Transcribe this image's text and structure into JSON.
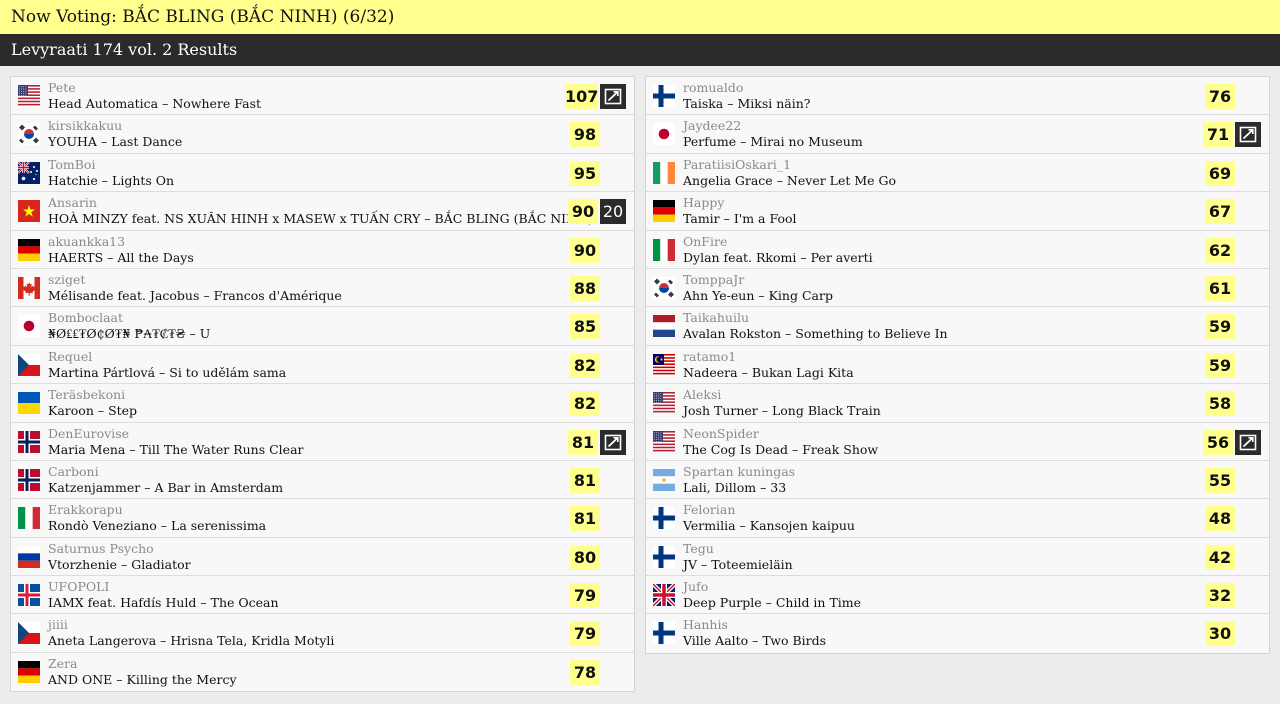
{
  "top_bar": {
    "text": "Now Voting: BẮC BLING (BẮC NINH) (6/32)"
  },
  "sub_bar": {
    "text": "Levyraati 174 vol. 2 Results"
  },
  "left": [
    {
      "flag": "us",
      "user": "Pete",
      "artist": "Head Automatica",
      "title": "Nowhere Fast",
      "score": "107",
      "badge": "check"
    },
    {
      "flag": "kr",
      "user": "kirsikkakuu",
      "artist": "YOUHA",
      "title": "Last Dance",
      "score": "98"
    },
    {
      "flag": "au",
      "user": "TomBoi",
      "artist": "Hatchie",
      "title": "Lights On",
      "score": "95"
    },
    {
      "flag": "vn",
      "user": "Ansarin",
      "artist": "HOÀ MINZY feat. NS XUÂN HINH x MASEW x TUẤN CRY",
      "title": "BẮC BLING (BẮC NINH)",
      "score": "90",
      "badge": "20"
    },
    {
      "flag": "de",
      "user": "akuankka13",
      "artist": "HAERTS",
      "title": "All the Days",
      "score": "90"
    },
    {
      "flag": "ca",
      "user": "sziget",
      "artist": "Mélisande feat. Jacobus",
      "title": "Francos d'Amérique",
      "score": "88"
    },
    {
      "flag": "jp",
      "user": "Bomboclaat",
      "artist": "₦Ø₤₤₮Ø₵Ø₮₦ ₱₳₮₡₮₴",
      "title": "U",
      "score": "85"
    },
    {
      "flag": "cz",
      "user": "Requel",
      "artist": "Martina Pártlová",
      "title": "Si to udělám sama",
      "score": "82"
    },
    {
      "flag": "ua",
      "user": "Teräsbekoni",
      "artist": "Karoon",
      "title": "Step",
      "score": "82"
    },
    {
      "flag": "no",
      "user": "DenEurovise",
      "artist": "Maria Mena",
      "title": "Till The Water Runs Clear",
      "score": "81",
      "badge": "check"
    },
    {
      "flag": "no",
      "user": "Carboni",
      "artist": "Katzenjammer",
      "title": "A Bar in Amsterdam",
      "score": "81"
    },
    {
      "flag": "it",
      "user": "Erakkorapu",
      "artist": "Rondò Veneziano",
      "title": "La serenissima",
      "score": "81"
    },
    {
      "flag": "ru",
      "user": "Saturnus Psycho",
      "artist": "Vtorzhenie",
      "title": "Gladiator",
      "score": "80"
    },
    {
      "flag": "is",
      "user": "UFOPOLI",
      "artist": "IAMX feat. Hafdís Huld",
      "title": "The Ocean",
      "score": "79"
    },
    {
      "flag": "cz",
      "user": "jiiii",
      "artist": "Aneta Langerova",
      "title": "Hrisna Tela, Kridla Motyli",
      "score": "79"
    },
    {
      "flag": "de",
      "user": "Zera",
      "artist": "AND ONE",
      "title": "Killing the Mercy",
      "score": "78"
    }
  ],
  "right": [
    {
      "flag": "fi",
      "user": "romualdo",
      "artist": "Taiska",
      "title": "Miksi näin?",
      "score": "76"
    },
    {
      "flag": "jp",
      "user": "Jaydee22",
      "artist": "Perfume",
      "title": "Mirai no Museum",
      "score": "71",
      "badge": "check"
    },
    {
      "flag": "ie",
      "user": "ParatiisiOskari_1",
      "artist": "Angelia Grace",
      "title": "Never Let Me Go",
      "score": "69"
    },
    {
      "flag": "de",
      "user": "Happy",
      "artist": "Tamir",
      "title": "I'm a Fool",
      "score": "67"
    },
    {
      "flag": "it",
      "user": "OnFire",
      "artist": "Dylan feat. Rkomi",
      "title": "Per averti",
      "score": "62"
    },
    {
      "flag": "kr",
      "user": "TomppaJr",
      "artist": "Ahn Ye-eun",
      "title": "King Carp",
      "score": "61"
    },
    {
      "flag": "nl",
      "user": "Taikahuilu",
      "artist": "Avalan Rokston",
      "title": "Something to Believe In",
      "score": "59"
    },
    {
      "flag": "my",
      "user": "ratamo1",
      "artist": "Nadeera",
      "title": "Bukan Lagi Kita",
      "score": "59"
    },
    {
      "flag": "us",
      "user": "Aleksi",
      "artist": "Josh Turner",
      "title": "Long Black Train",
      "score": "58"
    },
    {
      "flag": "us",
      "user": "NeonSpider",
      "artist": "The Cog Is Dead",
      "title": "Freak Show",
      "score": "56",
      "badge": "check"
    },
    {
      "flag": "ar",
      "user": "Spartan kuningas",
      "artist": "Lali, Dillom",
      "title": "33",
      "score": "55"
    },
    {
      "flag": "fi",
      "user": "Felorian",
      "artist": "Vermilia",
      "title": "Kansojen kaipuu",
      "score": "48"
    },
    {
      "flag": "fi",
      "user": "Tegu",
      "artist": "JV",
      "title": "Toteemieläin",
      "score": "42"
    },
    {
      "flag": "gb",
      "user": "Jufo",
      "artist": "Deep Purple",
      "title": "Child in Time",
      "score": "32"
    },
    {
      "flag": "fi",
      "user": "Hanhis",
      "artist": "Ville Aalto",
      "title": "Two Birds",
      "score": "30"
    }
  ]
}
